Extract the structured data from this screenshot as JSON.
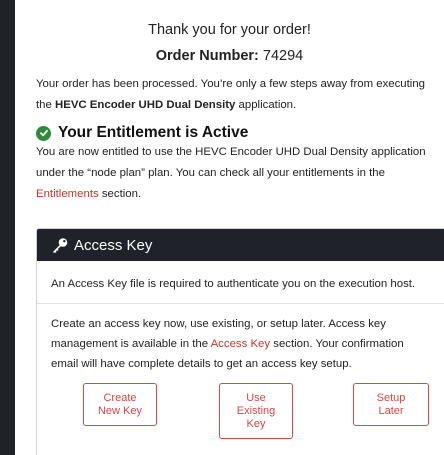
{
  "header": {
    "thank_you": "Thank you for your order!",
    "order_label": "Order Number:",
    "order_number": "74294"
  },
  "intro": {
    "text_before": "Your order has been processed. You’re only a few steps away from executing the ",
    "app_name": "HEVC Encoder UHD Dual Density",
    "text_after": " application."
  },
  "entitlement": {
    "heading": "Your Entitlement is Active",
    "text_before": "You are now entitled to use the HEVC Encoder UHD Dual Density application under the “node plan” plan. You can check all your entitlements in the ",
    "link": "Entitlements",
    "text_after": " section.",
    "icon": "check-circle-icon",
    "icon_color": "#2e8b3a"
  },
  "access_key": {
    "title": "Access Key",
    "icon": "key-icon",
    "required_text": "An Access Key file is required to authenticate you on the execution host.",
    "text_before": "Create an access key now, use existing, or setup later. Access key management is available in the ",
    "link": "Access Key",
    "text_after": " section. Your confirmation email will have complete details to get an access key setup.",
    "buttons": {
      "create": [
        "Create",
        "New Key"
      ],
      "use": [
        "Use",
        "Existing",
        "Key"
      ],
      "setup": [
        "Setup",
        "Later"
      ]
    }
  },
  "colors": {
    "accent": "#d44444",
    "link": "#c0392b",
    "dark": "#1f2228"
  }
}
